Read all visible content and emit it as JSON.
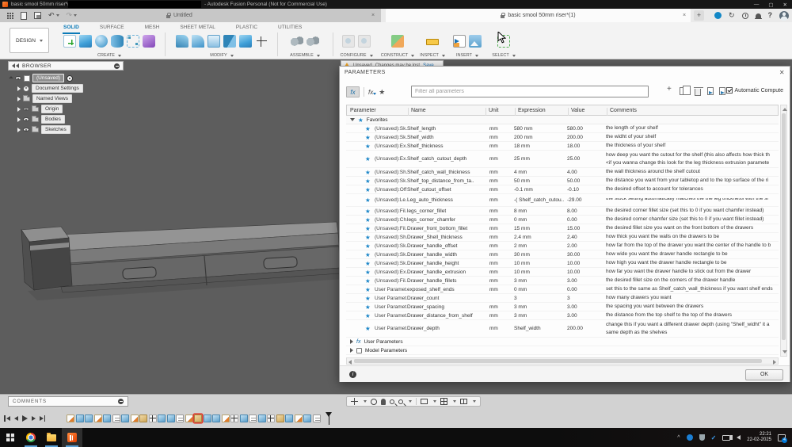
{
  "icons": {
    "plus": "+",
    "help": "?",
    "undo": "↶",
    "redo": "↷",
    "sync": "↻",
    "close": "✕",
    "close_small": "×",
    "chevron_up": "^",
    "fx": "fx",
    "star": "★",
    "info": "i",
    "minimize": "—",
    "maximize": "▢"
  },
  "titlebar": {
    "app_title_left": "basic smool 50mm riser*(1",
    "app_title_right": "- Autodesk Fusion Personal (Not for Commercial Use)"
  },
  "qat": {
    "tab_untitled": "Untitled",
    "tab_active": "basic smool 50mm riser*(1)"
  },
  "ribbon": {
    "design_label": "DESIGN",
    "active_tab": "SOLID",
    "tabs": [
      "SOLID",
      "SURFACE",
      "MESH",
      "SHEET METAL",
      "PLASTIC",
      "UTILITIES"
    ],
    "groups": [
      "CREATE",
      "MODIFY",
      "ASSEMBLE",
      "CONFIGURE",
      "CONSTRUCT",
      "INSPECT",
      "INSERT",
      "SELECT"
    ]
  },
  "browser": {
    "title": "BROWSER",
    "root_label": "(Unsaved)",
    "items": [
      {
        "label": "Document Settings",
        "icon": "gear",
        "eye": false,
        "dim": false
      },
      {
        "label": "Named Views",
        "icon": "folder",
        "eye": false,
        "dim": false
      },
      {
        "label": "Origin",
        "icon": "folder",
        "eye": true,
        "dim": true
      },
      {
        "label": "Bodies",
        "icon": "folder",
        "eye": true,
        "dim": false
      },
      {
        "label": "Sketches",
        "icon": "folder",
        "eye": true,
        "dim": false
      }
    ]
  },
  "notification": {
    "label": "Unsaved",
    "message": "Changes may be lost",
    "action": "Save"
  },
  "dialog": {
    "title": "PARAMETERS",
    "filter_placeholder": "Filter all parameters",
    "auto_compute": "Automatic Compute",
    "columns": [
      "Parameter",
      "Name",
      "Unit",
      "Expression",
      "Value",
      "Comments"
    ],
    "favorites_label": "Favorites",
    "group_user": "User Parameters",
    "group_model": "Model Parameters",
    "ok": "OK",
    "rows": [
      {
        "p": "(Unsaved):Sk..",
        "n": "Shelf_length",
        "u": "mm",
        "e": "580 mm",
        "v": "580.00",
        "c": "the length of your shelf"
      },
      {
        "p": "(Unsaved):Sk..",
        "n": "Shelf_width",
        "u": "mm",
        "e": "200 mm",
        "v": "200.00",
        "c": "the widht of your shelf"
      },
      {
        "p": "(Unsaved):Ex..",
        "n": "Shelf_thickness",
        "u": "mm",
        "e": "18 mm",
        "v": "18.00",
        "c": "the thickness of your shelf"
      },
      {
        "p": "(Unsaved):Ex..",
        "n": "Shelf_catch_cutout_depth",
        "u": "mm",
        "e": "25 mm",
        "v": "25.00",
        "c": "how deep you want the cutout for the shelf (this also affects how thick th",
        "c2": "<if you wanna change this look for the leg thickness extrusion paramete",
        "h": 2
      },
      {
        "p": "(Unsaved):Sh..",
        "n": "Shelf_catch_wall_thickness",
        "u": "mm",
        "e": "4 mm",
        "v": "4.00",
        "c": "the wall thickness around the shelf cutout"
      },
      {
        "p": "(Unsaved):Sk..",
        "n": "Shelf_top_distance_from_ta..",
        "u": "mm",
        "e": "50 mm",
        "v": "50.00",
        "c": "the distance you want from your tabletop and to the top surface of the ri"
      },
      {
        "p": "(Unsaved):Off..",
        "n": "Shelf_cutout_offset",
        "u": "mm",
        "e": "-0.1 mm",
        "v": "-0.10",
        "c": "the desired offset to account for tolerances"
      },
      {
        "p": "(Unsaved):Le..",
        "n": "Leg_auto_thickness",
        "u": "mm",
        "e": "-( Shelf_catch_cutou..",
        "v": "-29.00",
        "c": "the stock setting automatically matches the the leg thickness with the sl",
        "h": 1.5
      },
      {
        "p": "(Unsaved):Fil..",
        "n": "legs_corner_fillet",
        "u": "mm",
        "e": "8 mm",
        "v": "8.00",
        "c": "the desired corner fillet size (set this to 0 if you want chamfer instead)"
      },
      {
        "p": "(Unsaved):Ch..",
        "n": "legs_corner_chamfer",
        "u": "mm",
        "e": "0 mm",
        "v": "0.00",
        "c": "the desired corner chamfer size (set this to 0 if you want fillet instead)"
      },
      {
        "p": "(Unsaved):Fil..",
        "n": "Drawer_front_bottom_fillet",
        "u": "mm",
        "e": "15 mm",
        "v": "15.00",
        "c": "the desired fillet size you want on the front bottom of the drawers"
      },
      {
        "p": "(Unsaved):Sh..",
        "n": "Drawer_Shell_thickness",
        "u": "mm",
        "e": "2.4 mm",
        "v": "2.40",
        "c": "how thick you want the walls on the drawers to be"
      },
      {
        "p": "(Unsaved):Sk..",
        "n": "Drawer_handle_offset",
        "u": "mm",
        "e": "2 mm",
        "v": "2.00",
        "c": "how far from the top of the drawer you want the center of the handle to b"
      },
      {
        "p": "(Unsaved):Sk..",
        "n": "Drawer_handle_width",
        "u": "mm",
        "e": "30 mm",
        "v": "30.00",
        "c": "how wide you want the drawer handle rectangle to be"
      },
      {
        "p": "(Unsaved):Sk..",
        "n": "Drawer_handle_height",
        "u": "mm",
        "e": "10 mm",
        "v": "10.00",
        "c": "how high you want the drawer handle rectangle to be"
      },
      {
        "p": "(Unsaved):Ex..",
        "n": "Drawer_handle_extrusion",
        "u": "mm",
        "e": "10 mm",
        "v": "10.00",
        "c": "how far you want the drawer handle to stick out from the drawer"
      },
      {
        "p": "(Unsaved):Fil..",
        "n": "Drawer_handle_fillets",
        "u": "mm",
        "e": "3 mm",
        "v": "3.00",
        "c": "the desired fillet size on the corners of the drawer handle"
      },
      {
        "p": "User Paramet..",
        "n": "exposed_shelf_ends",
        "u": "mm",
        "e": "0 mm",
        "v": "0.00",
        "c": "set this to the same as Shelf_catch_wall_thickness if you want shelf ends"
      },
      {
        "p": "User Paramet..",
        "n": "Drawer_count",
        "u": "",
        "e": "3",
        "v": "3",
        "c": "how many drawers you want"
      },
      {
        "p": "User Paramet..",
        "n": "Drawer_spacing",
        "u": "mm",
        "e": "3 mm",
        "v": "3.00",
        "c": "the spacing you want between the drawers"
      },
      {
        "p": "User Paramet..",
        "n": "Drawer_distance_from_shelf",
        "u": "mm",
        "e": "3 mm",
        "v": "3.00",
        "c": "the distance from the top shelf to the top of the drawers"
      },
      {
        "p": "User Paramet..",
        "n": "Drawer_depth",
        "u": "mm",
        "e": "Shelf_width",
        "v": "200.00",
        "c": "change this if you want a different drawer depth (using \"Shelf_widht\" it a",
        "c2": "same depth as the shelves",
        "h": 2
      }
    ]
  },
  "comments": {
    "label": "COMMENTS"
  },
  "timeline": {
    "icons": [
      "sketch",
      "blue",
      "blue",
      "sketch",
      "blue",
      "doc",
      "blue",
      "sketch",
      "tan",
      "move",
      "blue",
      "blue",
      "doc",
      "sketch",
      "tan",
      "blue",
      "blue",
      "sketch",
      "move",
      "blue",
      "doc",
      "blue",
      "move",
      "tan",
      "blue",
      "sketch",
      "blue",
      "doc"
    ],
    "highlight_index": 14
  },
  "taskbar": {
    "time": "22:21",
    "date": "22-02-2025",
    "badge": "4"
  },
  "colors": {
    "accent": "#0696d7",
    "favorite_star": "#1c86c8",
    "viewport": "#5d5d5d",
    "highlight_red": "#e03c31"
  }
}
